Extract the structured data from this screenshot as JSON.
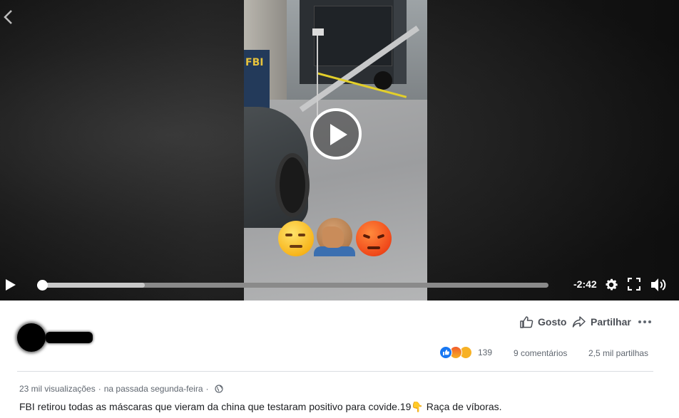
{
  "video": {
    "time_remaining": "-2:42",
    "progress_fraction": 0.0,
    "buffered_fraction": 0.21,
    "overlay_emojis": [
      "unamused-face",
      "facepalm-person",
      "angry-face"
    ],
    "frame_text": "FBI",
    "icons": {
      "back": "chevron-left-icon",
      "play_overlay": "play-circle-icon",
      "play": "play-icon",
      "settings": "gear-icon",
      "fullscreen": "fullscreen-icon",
      "volume": "volume-icon"
    }
  },
  "post": {
    "actions": {
      "like_label": "Gosto",
      "share_label": "Partilhar"
    },
    "reactions": {
      "types": [
        "like",
        "angry",
        "wow"
      ],
      "count": "139"
    },
    "comments": "9 comentários",
    "shares": "2,5 mil partilhas",
    "views": "23 mil visualizações",
    "meta_separator": "·",
    "posted": "na passada segunda-feira",
    "audience_icon": "globe-icon",
    "caption": "FBI retirou todas as máscaras que vieram da china que testaram positivo para covide.19👇 Raça de víboras."
  },
  "colors": {
    "accent_like": "#1877f2",
    "text_secondary": "#606770",
    "text_primary": "#1c1e21",
    "video_bg": "#161616"
  }
}
